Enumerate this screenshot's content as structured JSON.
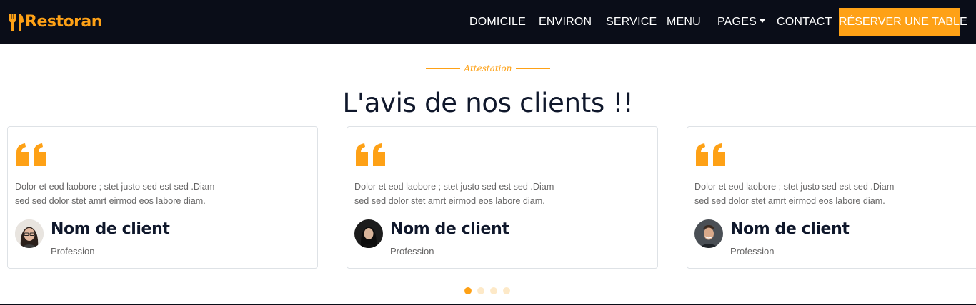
{
  "brand": {
    "name": "Restoran",
    "logo_icon": "utensils-icon",
    "accent_color": "#fea116"
  },
  "nav": {
    "items": [
      {
        "label": "DOMICILE"
      },
      {
        "label": "ENVIRON"
      },
      {
        "label": "SERVICE"
      },
      {
        "label": "MENU"
      },
      {
        "label": "PAGES",
        "has_dropdown": true
      },
      {
        "label": "CONTACT"
      }
    ],
    "cta_label": "RÉSERVER UNE TABLE",
    "background": "#0a0d18"
  },
  "section": {
    "tag": "Attestation",
    "title": "L'avis de nos clients !!"
  },
  "testimonials": [
    {
      "text_line1": "Dolor et eod laobore ; stet justo sed est sed .Diam",
      "text_line2": "sed sed dolor stet amrt eirmod eos labore diam.",
      "name": "Nom de client",
      "profession": "Profession",
      "avatar": "avatar-woman-glasses"
    },
    {
      "text_line1": "Dolor et eod laobore ; stet justo sed est sed .Diam",
      "text_line2": "sed sed dolor stet amrt eirmod eos labore diam.",
      "name": "Nom de client",
      "profession": "Profession",
      "avatar": "avatar-woman-dark"
    },
    {
      "text_line1": "Dolor et eod laobore ; stet justo sed est sed .Diam",
      "text_line2": "sed sed dolor stet amrt eirmod eos labore diam.",
      "name": "Nom de client",
      "profession": "Profession",
      "avatar": "avatar-man-smiling"
    }
  ],
  "carousel": {
    "dot_count": 4,
    "active_index": 0
  }
}
